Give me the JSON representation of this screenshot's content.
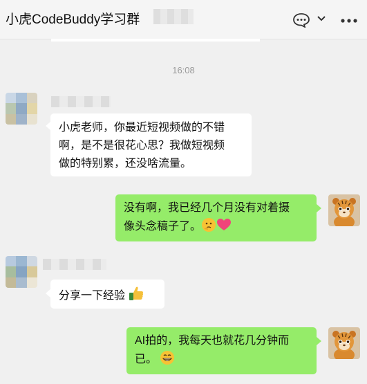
{
  "header": {
    "title": "小虎CodeBuddy学习群",
    "icons": [
      "chat-bubble-icon",
      "chevron-down-icon",
      "more-icon"
    ]
  },
  "timestamp": "16:08",
  "messages": [
    {
      "side": "in",
      "text_lines": [
        "小虎老师，你最近短视频做的不错",
        "啊，是不是很花心思？我做短视频",
        "做的特别累，还没啥流量。"
      ]
    },
    {
      "side": "out",
      "text_lines": [
        "没有啊，我已经几个月没有对着摄",
        "像头念稿子了。"
      ],
      "emojis": [
        "thinking-emoji",
        "heart-emoji"
      ]
    },
    {
      "side": "in",
      "text_lines": [
        "分享一下经验"
      ],
      "emojis": [
        "thumbs-up-emoji"
      ]
    },
    {
      "side": "out",
      "text_lines": [
        "AI拍的，我每天也就花几分钟而",
        "已。"
      ],
      "emojis": [
        "grin-emoji"
      ]
    }
  ],
  "colors": {
    "incoming_bubble": "#ffffff",
    "outgoing_bubble": "#95ec69",
    "background": "#f0f0f0"
  }
}
